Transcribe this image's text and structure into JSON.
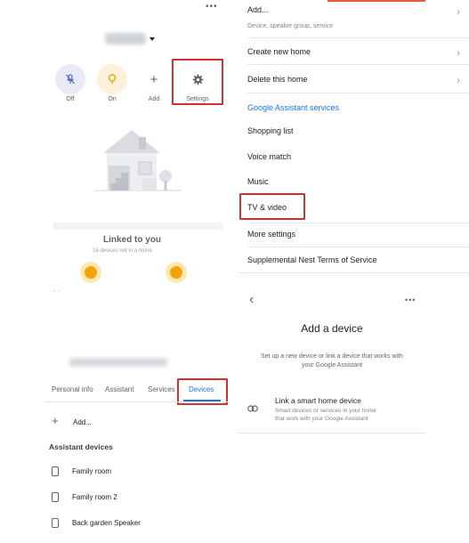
{
  "home_panel": {
    "overflow_icon": "more-horizontal-icon",
    "home_name": "Stuo",
    "shortcuts": [
      {
        "label": "Off",
        "icon": "mic-off-icon",
        "color": "#e8eaf6",
        "icon_color": "#5c6bc0"
      },
      {
        "label": "On",
        "icon": "bulb-icon",
        "color": "#fdf1dc",
        "icon_color": "#f4a300"
      },
      {
        "label": "Add",
        "icon": "plus-icon",
        "color": "#f1f3f4",
        "icon_color": "#5f6368"
      },
      {
        "label": "Settings",
        "icon": "gear-icon",
        "color": "#f1f3f4",
        "icon_color": "#5f6368"
      }
    ],
    "linked_title": "Linked to you",
    "linked_subtitle": "16 devices not in a home"
  },
  "settings_menu": {
    "items": [
      {
        "label": "Add...",
        "sublabel": "Device, speaker group, service",
        "chevron": true
      },
      {
        "label": "Create new home",
        "chevron": true
      },
      {
        "label": "Delete this home",
        "chevron": true
      }
    ],
    "section_header": "Google Assistant services",
    "services": [
      "Shopping list",
      "Voice match",
      "Music",
      "TV & video",
      "More settings",
      "Supplemental Nest Terms of Service"
    ],
    "accent_color": "#1a73e8"
  },
  "add_device_panel": {
    "back_icon": "back-arrow-icon",
    "overflow_icon": "more-horizontal-icon",
    "title": "Add a device",
    "description_line1": "Set up a new device or link a device that works with",
    "description_line2": "your Google Assistant",
    "option": {
      "icon": "link-icon",
      "title": "Link a smart home device",
      "subtitle_line1": "Smart devices or services in your home",
      "subtitle_line2": "that work with your Google Assistant"
    }
  },
  "profile_panel": {
    "back_hint": "- -",
    "account_email": "",
    "tabs": [
      "Personal info",
      "Assistant",
      "Services",
      "Devices"
    ],
    "active_tab": "Devices",
    "add_label": "Add...",
    "section_title": "Assistant devices",
    "devices": [
      {
        "name": "Family room",
        "icon": "speaker-icon"
      },
      {
        "name": "Family room 2",
        "icon": "speaker-icon"
      },
      {
        "name": "Back garden Speaker",
        "icon": "speaker-icon"
      }
    ]
  },
  "highlight_color": "#d32f2f"
}
